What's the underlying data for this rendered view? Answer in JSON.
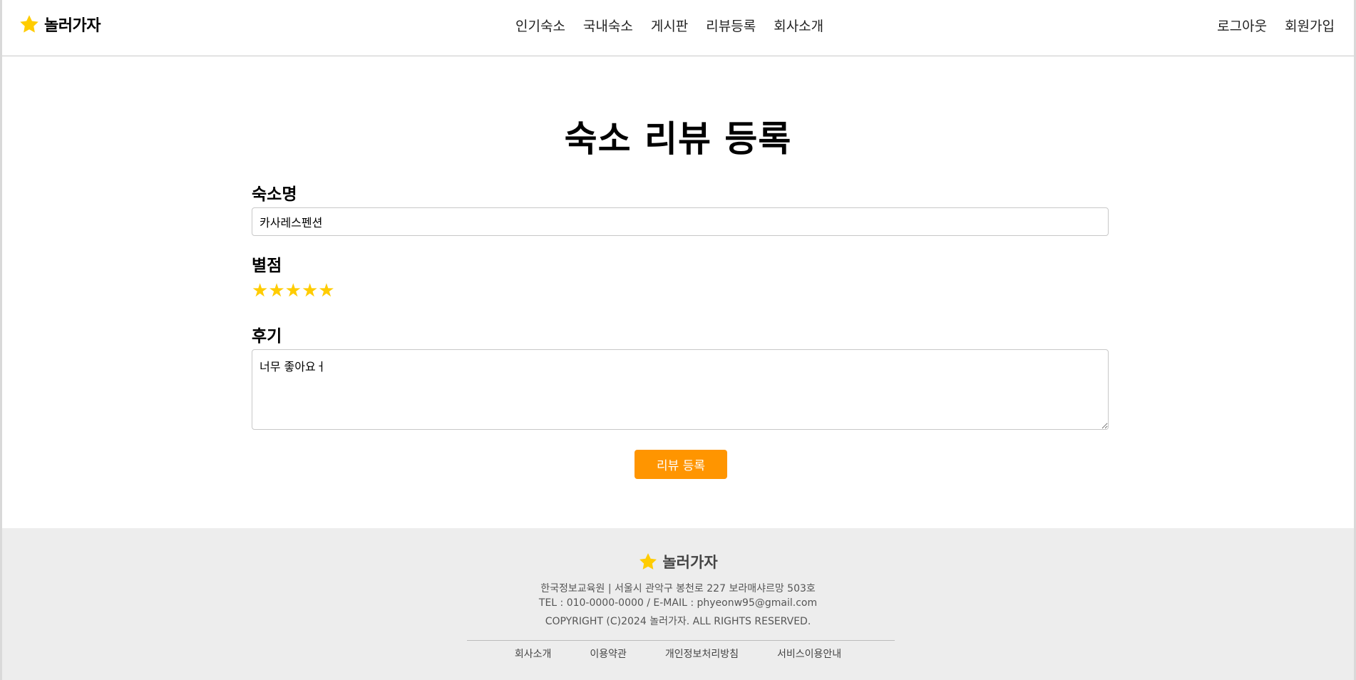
{
  "header": {
    "brand": "놀러가자",
    "nav": [
      "인기숙소",
      "국내숙소",
      "게시판",
      "리뷰등록",
      "회사소개"
    ],
    "auth": {
      "logout": "로그아웃",
      "signup": "회원가입"
    }
  },
  "main": {
    "title": "숙소 리뷰 등록",
    "name_label": "숙소명",
    "name_value": "카사레스펜션",
    "rating_label": "별점",
    "rating": {
      "value": 5,
      "max": 5,
      "color": "#ffcc00"
    },
    "review_label": "후기",
    "review_value": "너무 좋아요ㅓ",
    "submit_label": "리뷰 등록"
  },
  "footer": {
    "brand": "놀러가자",
    "line1": "한국정보교육원 | 서울시 관악구 봉천로 227 보라매샤르망 503호",
    "line2": "TEL : 010-0000-0000 / E-MAIL : phyeonw95@gmail.com",
    "line3": "COPYRIGHT (C)2024 놀러가자. ALL RIGHTS RESERVED.",
    "links": [
      "회사소개",
      "이용약관",
      "개인정보처리방침",
      "서비스이용안내"
    ]
  },
  "colors": {
    "accent": "#ff9500",
    "star": "#ffcc00",
    "footer_bg": "#ededed"
  }
}
